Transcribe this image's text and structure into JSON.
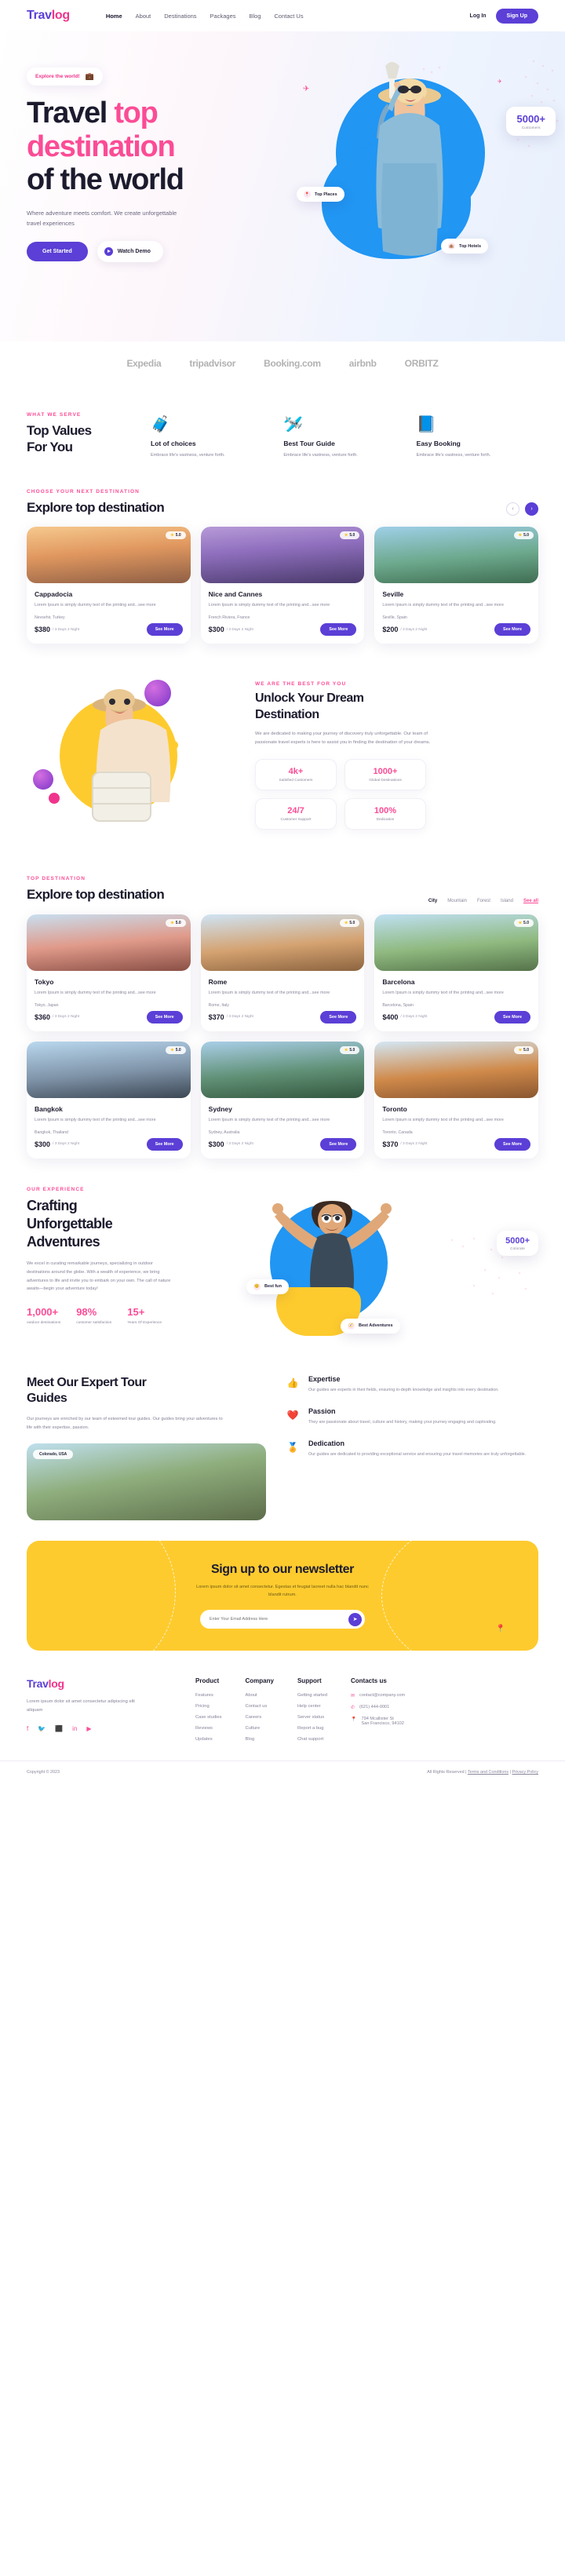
{
  "brand": {
    "part1": "Trav",
    "part2": "log"
  },
  "header": {
    "nav": [
      {
        "label": "Home",
        "active": true
      },
      {
        "label": "About",
        "active": false
      },
      {
        "label": "Destinations",
        "active": false
      },
      {
        "label": "Packages",
        "active": false
      },
      {
        "label": "Blog",
        "active": false
      },
      {
        "label": "Contact Us",
        "active": false
      }
    ],
    "login_label": "Log In",
    "signup_label": "Sign Up"
  },
  "hero": {
    "pill_text": "Explore the world!",
    "pill_icon": "briefcase-icon",
    "title_line1_dark": "Travel ",
    "title_line1_pink": "top",
    "title_line2_pink": "destination",
    "title_line3_dark": "of the world",
    "subtitle": "Where adventure meets comfort. We create unforgettable travel experiences",
    "primary_cta": "Get Started",
    "secondary_cta": "Watch Demo",
    "badge_places": "Top Places",
    "badge_hotels": "Top Hotels",
    "counter_value": "5000+",
    "counter_label": "Customers"
  },
  "partners": [
    "Expedia",
    "tripadvisor",
    "Booking.com",
    "airbnb",
    "ORBITZ"
  ],
  "values": {
    "kicker": "WHAT WE SERVE",
    "heading_line1": "Top Values",
    "heading_line2": "For You",
    "items": [
      {
        "icon": "luggage-globe-icon",
        "title": "Lot of choices",
        "desc": "Embrace life's vastness, venture forth."
      },
      {
        "icon": "paper-plane-icon",
        "title": "Best Tour Guide",
        "desc": "Embrace life's vastness, venture forth."
      },
      {
        "icon": "book-icon",
        "title": "Easy Booking",
        "desc": "Embrace life's vastness, venture forth."
      }
    ]
  },
  "explore": {
    "kicker": "CHOOSE YOUR NEXT DESTINATION",
    "heading": "Explore top destination",
    "prev_icon": "chevron-left-icon",
    "next_icon": "chevron-right-icon",
    "cards": [
      {
        "name": "Cappadocia",
        "rating": "5.0",
        "desc": "Lorem Ipsum is simply dummy text of the printing and...see more",
        "location": "Nevsehir, Turkey",
        "price": "$380",
        "per": "/ 3 Days 2 Night",
        "cta": "See More",
        "ph": "ph-cap"
      },
      {
        "name": "Nice and Cannes",
        "rating": "5.0",
        "desc": "Lorem Ipsum is simply dummy text of the printing and...see more",
        "location": "French Riviera, France",
        "price": "$300",
        "per": "/ 3 Days 2 Night",
        "cta": "See More",
        "ph": "ph-nice"
      },
      {
        "name": "Seville",
        "rating": "5.0",
        "desc": "Lorem Ipsum is simply dummy text of the printing and...see more",
        "location": "Seville, Spain",
        "price": "$200",
        "per": "/ 3 Days 2 Night",
        "cta": "See More",
        "ph": "ph-sev"
      }
    ]
  },
  "unlock": {
    "kicker": "WE ARE THE BEST FOR YOU",
    "heading_line1": "Unlock Your Dream",
    "heading_line2": "Destination",
    "desc": "We are dedicated to making your journey of discovery truly unforgettable. Our team of passionate travel experts is here to assist you in finding the destination of your dreams.",
    "stats": [
      {
        "value": "4k+",
        "label": "Satisfied Customers"
      },
      {
        "value": "1000+",
        "label": "Global Destinations"
      },
      {
        "value": "24/7",
        "label": "Customer Support"
      },
      {
        "value": "100%",
        "label": "Dedication"
      }
    ]
  },
  "topdest": {
    "kicker": "TOP DESTINATION",
    "heading": "Explore top destination",
    "tabs": [
      {
        "label": "City",
        "on": true
      },
      {
        "label": "Mountain",
        "on": false
      },
      {
        "label": "Forest",
        "on": false
      },
      {
        "label": "Island",
        "on": false
      },
      {
        "label": "See all",
        "on": false,
        "all": true
      }
    ],
    "cards": [
      {
        "name": "Tokyo",
        "rating": "5.0",
        "desc": "Lorem Ipsum is simply dummy text of the printing and...see more",
        "location": "Tokyo, Japan",
        "price": "$360",
        "per": "/ 3 Days 2 Night",
        "cta": "See More",
        "ph": "ph-tok"
      },
      {
        "name": "Rome",
        "rating": "5.0",
        "desc": "Lorem Ipsum is simply dummy text of the printing and...see more",
        "location": "Rome, Italy",
        "price": "$370",
        "per": "/ 3 Days 2 Night",
        "cta": "See More",
        "ph": "ph-rom"
      },
      {
        "name": "Barcelona",
        "rating": "5.0",
        "desc": "Lorem Ipsum is simply dummy text of the printing and...see more",
        "location": "Barcelona, Spain",
        "price": "$400",
        "per": "/ 3 Days 2 Night",
        "cta": "See More",
        "ph": "ph-bar"
      },
      {
        "name": "Bangkok",
        "rating": "5.0",
        "desc": "Lorem Ipsum is simply dummy text of the printing and...see more",
        "location": "Bangkok, Thailand",
        "price": "$300",
        "per": "/ 3 Days 2 Night",
        "cta": "See More",
        "ph": "ph-ban"
      },
      {
        "name": "Sydney",
        "rating": "5.0",
        "desc": "Lorem Ipsum is simply dummy text of the printing and...see more",
        "location": "Sydney, Australia",
        "price": "$300",
        "per": "/ 3 Days 2 Night",
        "cta": "See More",
        "ph": "ph-syd"
      },
      {
        "name": "Toronto",
        "rating": "5.0",
        "desc": "Lorem Ipsum is simply dummy text of the printing and...see more",
        "location": "Toronto, Canada",
        "price": "$370",
        "per": "/ 3 Days 2 Night",
        "cta": "See More",
        "ph": "ph-tor"
      }
    ]
  },
  "craft": {
    "kicker": "Our Experience",
    "heading_line1": "Crafting",
    "heading_line2": "Unforgettable",
    "heading_line3": "Adventures",
    "desc": "We excel in curating remarkable journeys, specializing in outdoor destinations around the globe. With a wealth of experience, we bring adventures to life and invite you to embark on your own. The call of nature awaits—begin your adventure today!",
    "stats": [
      {
        "value": "1,000+",
        "label": "outdoor destinations"
      },
      {
        "value": "98%",
        "label": "customer satisfaction"
      },
      {
        "value": "15+",
        "label": "Years Of Experience"
      }
    ],
    "badge_best": "Best Adventures",
    "badge_fun": "Best fun",
    "counter_value": "5000+",
    "counter_label": "Colorate"
  },
  "guides": {
    "heading_line1": "Meet Our Expert Tour",
    "heading_line2": "Guides",
    "desc": "Our journeys are enriched by our team of esteemed tour guides. Our guides bring your adventures to life with their expertise, passion.",
    "photo_badge": "Colorado, USA",
    "items": [
      {
        "icon": "thumbs-up-icon",
        "title": "Expertise",
        "desc": "Our guides are experts in their fields, ensuring in-depth knowledge and insights into every destination."
      },
      {
        "icon": "heart-icon",
        "title": "Passion",
        "desc": "They are passionate about travel, culture and history, making your journey engaging and captivating."
      },
      {
        "icon": "medal-icon",
        "title": "Dedication",
        "desc": "Our guides are dedicated to providing exceptional service and ensuring your travel memories are truly unforgettable."
      }
    ]
  },
  "newsletter": {
    "heading": "Sign up to our newsletter",
    "desc": "Lorem ipsum dolor sit amet consectetur. Egestas et feugiat laoreet nulla hac blandit nunc blandit rutrum.",
    "placeholder": "Enter Your Email Address Here",
    "send_icon": "send-icon"
  },
  "footer": {
    "desc": "Lorem ipsum dolor sit amet consectetur adipiscing elit aliquam",
    "socials": [
      "facebook-icon",
      "twitter-icon",
      "instagram-icon",
      "linkedin-icon",
      "youtube-icon"
    ],
    "columns": [
      {
        "title": "Product",
        "links": [
          "Features",
          "Pricing",
          "Case studies",
          "Reviews",
          "Updates"
        ]
      },
      {
        "title": "Company",
        "links": [
          "About",
          "Contact us",
          "Careers",
          "Culture",
          "Blog"
        ]
      },
      {
        "title": "Support",
        "links": [
          "Getting started",
          "Help center",
          "Server status",
          "Report a bug",
          "Chat support"
        ]
      }
    ],
    "contact_title": "Contacts us",
    "contacts": [
      {
        "icon": "mail-icon",
        "text": "contact@company.com"
      },
      {
        "icon": "phone-icon",
        "text": "(621) 444-0001"
      },
      {
        "icon": "pin-icon",
        "text": "794 Mcallister St\nSan Francisco, 94102"
      }
    ],
    "copyright": "Copyright © 2023",
    "rights": "All Rights Reserved |",
    "terms": "Terms and Conditions",
    "sep": "|",
    "privacy": "Privacy Policy"
  }
}
